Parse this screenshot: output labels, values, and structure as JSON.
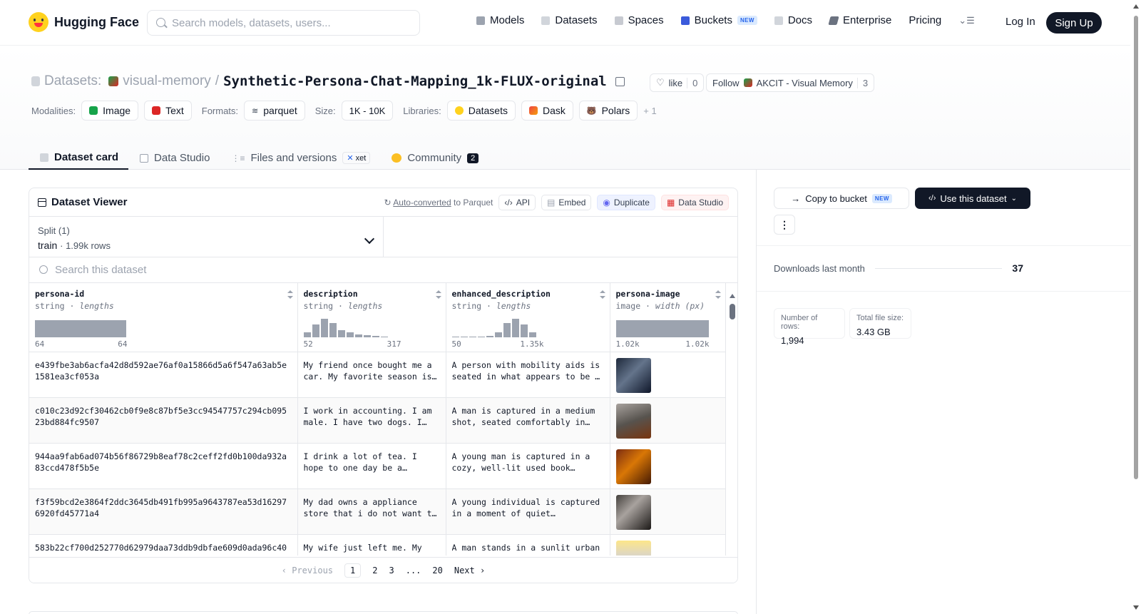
{
  "nav": {
    "brand": "Hugging Face",
    "search_placeholder": "Search models, datasets, users...",
    "links": [
      "Models",
      "Datasets",
      "Spaces",
      "Buckets",
      "Docs",
      "Enterprise",
      "Pricing"
    ],
    "buckets_badge": "NEW",
    "login": "Log In",
    "signup": "Sign Up"
  },
  "header": {
    "datasets_label": "Datasets:",
    "org": "visual-memory",
    "sep": "/",
    "repo": "Synthetic-Persona-Chat-Mapping_1k-FLUX-original",
    "like_label": "like",
    "like_count": "0",
    "follow_label": "Follow",
    "follow_org": "AKCIT - Visual Memory",
    "follow_count": "3"
  },
  "tags": {
    "modalities_label": "Modalities:",
    "modalities": [
      "Image",
      "Text"
    ],
    "formats_label": "Formats:",
    "format": "parquet",
    "size_label": "Size:",
    "size": "1K - 10K",
    "libraries_label": "Libraries:",
    "libraries": [
      "Datasets",
      "Dask",
      "Polars"
    ],
    "more": "+ 1"
  },
  "tabs": {
    "card": "Dataset card",
    "studio": "Data Studio",
    "files": "Files and versions",
    "xet": "xet",
    "community": "Community",
    "community_count": "2"
  },
  "viewer": {
    "title": "Dataset Viewer",
    "converted": "Auto-converted",
    "converted_suffix": "to Parquet",
    "api": "API",
    "embed": "Embed",
    "duplicate": "Duplicate",
    "studio": "Data Studio",
    "split_label": "Split (1)",
    "split_name": "train",
    "split_rows": "1.99k rows",
    "search_placeholder": "Search this dataset",
    "columns": [
      {
        "name": "persona-id",
        "type": "string",
        "kind": "lengths",
        "min": "64",
        "max": "64"
      },
      {
        "name": "description",
        "type": "string",
        "kind": "lengths",
        "min": "52",
        "max": "317"
      },
      {
        "name": "enhanced_description",
        "type": "string",
        "kind": "lengths",
        "min": "50",
        "max": "1.35k"
      },
      {
        "name": "persona-image",
        "type": "image",
        "kind": "width (px)",
        "min": "1.02k",
        "max": "1.02k"
      }
    ],
    "rows": [
      {
        "id": "e439fbe3ab6acfa42d8d592ae76af0a15866d5a6f547a63ab5e1581ea3cf053a",
        "desc": "My friend once bought me a car. My favorite season is…",
        "enh": "A person with mobility aids is seated in what appears to be …"
      },
      {
        "id": "c010c23d92cf30462cb0f9e8c87bf5e3cc94547757c294cb09523bd884fc9507",
        "desc": "I work in accounting. I am male. I have two dogs. I…",
        "enh": "A man is captured in a medium shot, seated comfortably in…"
      },
      {
        "id": "944aa9fab6ad074b56f86729b8eaf78c2ceff2fd0b100da932a83ccd478f5b5e",
        "desc": "I drink a lot of tea. I hope to one day be a…",
        "enh": "A young man is captured in a cozy, well-lit used book…"
      },
      {
        "id": "f3f59bcd2e3864f2ddc3645db491fb995a9643787ea53d162976920fd45771a4",
        "desc": "My dad owns a appliance store that i do not want t…",
        "enh": "A young individual is captured in a moment of quiet…"
      },
      {
        "id": "583b22cf700d252770d62979daa73ddb9dbfae609d0ada96c40",
        "desc": "My wife just left me. My",
        "enh": "A man stands in a sunlit urban"
      }
    ],
    "pager": {
      "prev": "Previous",
      "pages": [
        "1",
        "2",
        "3",
        "...",
        "20"
      ],
      "next": "Next"
    }
  },
  "sidebar": {
    "copy_bucket": "Copy to bucket",
    "copy_badge": "NEW",
    "use_dataset": "Use this dataset",
    "more": "⋮",
    "downloads_label": "Downloads last month",
    "downloads": "37",
    "rows_label": "Number of rows:",
    "rows": "1,994",
    "filesize_label": "Total file size:",
    "filesize": "3.43 GB"
  }
}
